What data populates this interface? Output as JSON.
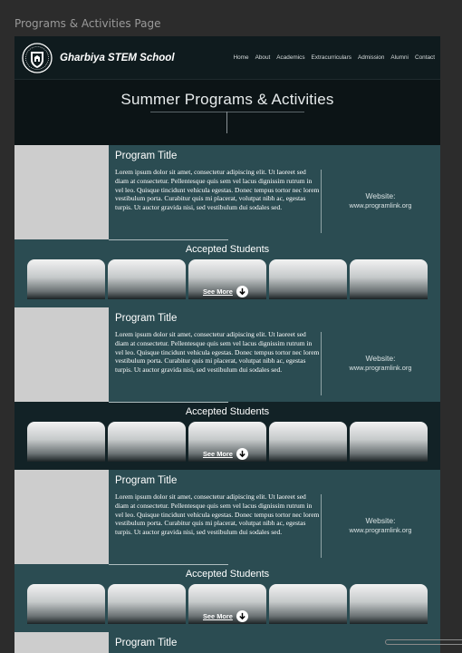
{
  "frame": {
    "label": "Programs & Activities Page"
  },
  "navbar": {
    "school_name": "Gharbiya STEM School",
    "links": [
      "Home",
      "About",
      "Academics",
      "Extracurriculars",
      "Admission",
      "Alumni",
      "Contact"
    ]
  },
  "hero": {
    "title": "Summer Programs & Activities"
  },
  "programs": [
    {
      "title": "Program Title",
      "description": "Lorem ipsum dolor sit amet, consectetur adipiscing elit. Ut laoreet sed diam at consectetur. Pellentesque quis sem vel lacus dignissim rutrum in vel leo. Quisque tincidunt vehicula egestas. Donec tempus tortor nec lorem vestibulum porta. Curabitur quis mi placerat, volutpat nibh ac, egestas turpis. Ut auctor gravida nisi, sed vestibulum dui sodales sed.",
      "website_label": "Website:",
      "website_url": "www.programlink.org",
      "accepted_title": "Accepted Students",
      "see_more": "See More"
    },
    {
      "title": "Program Title",
      "description": "Lorem ipsum dolor sit amet, consectetur adipiscing elit. Ut laoreet sed diam at consectetur. Pellentesque quis sem vel lacus dignissim rutrum in vel leo. Quisque tincidunt vehicula egestas. Donec tempus tortor nec lorem vestibulum porta. Curabitur quis mi placerat, volutpat nibh ac, egestas turpis. Ut auctor gravida nisi, sed vestibulum dui sodales sed.",
      "website_label": "Website:",
      "website_url": "www.programlink.org",
      "accepted_title": "Accepted Students",
      "see_more": "See More"
    },
    {
      "title": "Program Title",
      "description": "Lorem ipsum dolor sit amet, consectetur adipiscing elit. Ut laoreet sed diam at consectetur. Pellentesque quis sem vel lacus dignissim rutrum in vel leo. Quisque tincidunt vehicula egestas. Donec tempus tortor nec lorem vestibulum porta. Curabitur quis mi placerat, volutpat nibh ac, egestas turpis. Ut auctor gravida nisi, sed vestibulum dui sodales sed.",
      "website_label": "Website:",
      "website_url": "www.programlink.org",
      "accepted_title": "Accepted Students",
      "see_more": "See More"
    },
    {
      "title": "Program Title"
    }
  ],
  "colors": {
    "accent_teal": "#2b4c52",
    "dark_band": "#122226",
    "background": "#0c1416"
  },
  "icons": {
    "logo": "school-crest-icon",
    "see_more": "arrow-down-circle-icon"
  }
}
